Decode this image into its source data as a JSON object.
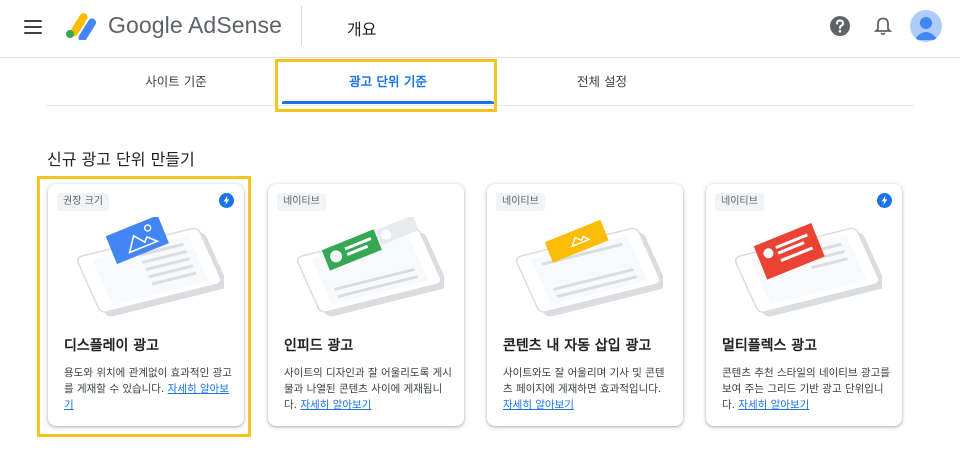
{
  "header": {
    "brand": "Google AdSense",
    "page_title": "개요",
    "icons": [
      "menu-icon",
      "adsense-logo",
      "help-icon",
      "notifications-bell-icon",
      "account-avatar"
    ]
  },
  "tabs": [
    {
      "label": "사이트 기준",
      "active": false
    },
    {
      "label": "광고 단위 기준",
      "active": true
    },
    {
      "label": "전체 설정",
      "active": false
    }
  ],
  "section_title": "신규 광고 단위 만들기",
  "cards": [
    {
      "chip": "권장 크기",
      "title": "디스플레이 광고",
      "desc": "용도와 위치에 관계없이 효과적인 광고를 게재할 수 있습니다.",
      "link": "자세히 알아보기",
      "badge": "bolt-icon",
      "ad_color": "#4285f4"
    },
    {
      "chip": "네이티브",
      "title": "인피드 광고",
      "desc": "사이트의 디자인과 잘 어울리도록 게시물과 나열된 콘텐츠 사이에 게재됩니다.",
      "link": "자세히 알아보기",
      "badge": "",
      "ad_color": "#34a853"
    },
    {
      "chip": "네이티브",
      "title": "콘텐츠 내 자동 삽입 광고",
      "desc": "사이트와도 잘 어울리며 기사 및 콘텐츠 페이지에 게재하면 효과적입니다.",
      "link": "자세히 알아보기",
      "badge": "",
      "ad_color": "#fbbc04"
    },
    {
      "chip": "네이티브",
      "title": "멀티플렉스 광고",
      "desc": "콘텐츠 추천 스타일의 네이티브 광고를 보여 주는 그리드 기반 광고 단위입니다.",
      "link": "자세히 알아보기",
      "badge": "bolt-icon",
      "ad_color": "#ea4335"
    }
  ],
  "colors": {
    "accent": "#1a73e8",
    "highlight": "#f4c51d"
  }
}
